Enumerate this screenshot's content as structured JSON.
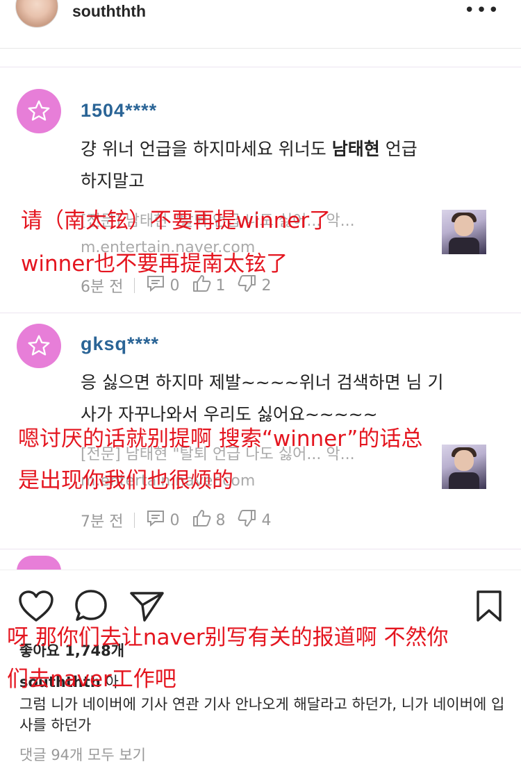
{
  "header": {
    "username": "souththth",
    "more_label": "•••"
  },
  "comments": [
    {
      "user": "1504****",
      "text_pre": "걍 위너 언급을 하지마세요 위너도 ",
      "text_bold": "남태현",
      "text_post": " 언급",
      "text_line2": "하지말고",
      "link_title": "[전문] 남태현 \"탈퇴 언급 나도 싫어... 악...",
      "link_domain": "m.entertain.naver.com",
      "time": "6분 전",
      "replies": "0",
      "likes": "1",
      "dislikes": "2"
    },
    {
      "user": "gksq****",
      "text_line1": "응 싫으면 하지마 제발~~~~위너 검색하면 님 기",
      "text_line2": "사가 자꾸나와서 우리도 싫어요~~~~~",
      "link_title": "[전문] 남태현 \"탈퇴 언급 나도 싫어... 악...",
      "link_domain": "m.entertain.naver.com",
      "time": "7분 전",
      "replies": "0",
      "likes": "8",
      "dislikes": "4"
    }
  ],
  "overlays": {
    "o1": "请（南太铉）不要再提winner了",
    "o2": "winner也不要再提南太铉了",
    "o3": "嗯讨厌的话就别提啊 搜索“winner”的话总",
    "o4": "是出现你我们也很烦的",
    "o5": "呀 那你们去让naver别写有关的报道啊 不然你",
    "o6": "们去naver工作吧"
  },
  "post": {
    "likes": "좋아요 1,748개",
    "caption_user": "souththth",
    "caption_suffix": " 아",
    "caption_text": "그럼 니가 네이버에 기사 연관 기사 안나오게 해달라고 하던가, 니가 네이버에 입사를 하던가",
    "view_all": "댓글 94개 모두 보기"
  },
  "colors": {
    "accent_red": "#e4151f",
    "avatar_pink": "#e77ed8",
    "username_blue": "#2a6496"
  }
}
